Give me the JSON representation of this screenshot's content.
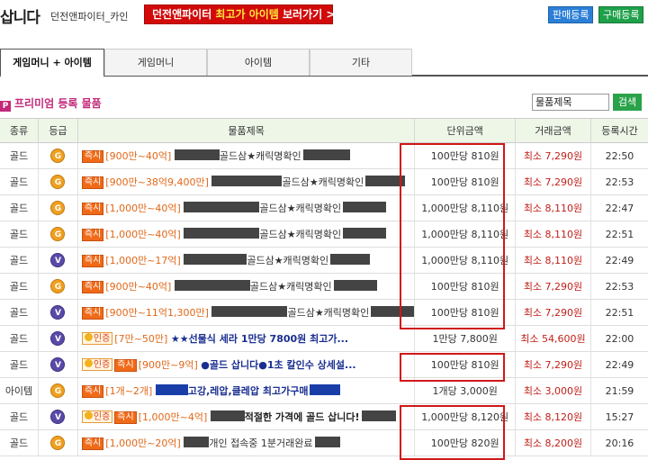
{
  "header": {
    "title": "삽니다",
    "subtitle": "던전앤파이터_카인",
    "banner_part1": "던전앤파이터 ",
    "banner_highlight": "최고가 아이템",
    "banner_part2": " 보러가기 >",
    "sell_button": "판매등록",
    "buy_button": "구매등록"
  },
  "tabs": [
    "게임머니 + 아이템",
    "게임머니",
    "아이템",
    "기타"
  ],
  "premium_label": "프리미엄 등록 물품",
  "search": {
    "select_value": "물품제목",
    "button": "검색"
  },
  "table": {
    "headers": [
      "종류",
      "등급",
      "물품제목",
      "단위금액",
      "거래금액",
      "등록시간"
    ],
    "rows": [
      {
        "type": "골드",
        "grade": "G",
        "badges": [
          "즉시"
        ],
        "range": "[900만~40억]",
        "title": "골드삼★캐릭명확인",
        "unit": "100만당 810원",
        "trade": "최소 7,290원",
        "time": "22:50"
      },
      {
        "type": "골드",
        "grade": "G",
        "badges": [
          "즉시"
        ],
        "range": "[900만~38억9,400만]",
        "title": "골드삼★캐릭명확인",
        "unit": "100만당 810원",
        "trade": "최소 7,290원",
        "time": "22:53"
      },
      {
        "type": "골드",
        "grade": "G",
        "badges": [
          "즉시"
        ],
        "range": "[1,000만~40억]",
        "title": "골드삼★캐릭명확인",
        "unit": "1,000만당 8,110원",
        "trade": "최소 8,110원",
        "time": "22:47"
      },
      {
        "type": "골드",
        "grade": "G",
        "badges": [
          "즉시"
        ],
        "range": "[1,000만~40억]",
        "title": "골드삼★캐릭명확인",
        "unit": "1,000만당 8,110원",
        "trade": "최소 8,110원",
        "time": "22:51"
      },
      {
        "type": "골드",
        "grade": "V",
        "badges": [
          "즉시"
        ],
        "range": "[1,000만~17억]",
        "title": "골드삼★캐릭명확인",
        "unit": "1,000만당 8,110원",
        "trade": "최소 8,110원",
        "time": "22:49"
      },
      {
        "type": "골드",
        "grade": "G",
        "badges": [
          "즉시"
        ],
        "range": "[900만~40억]",
        "title": "골드삼★캐릭명확인",
        "unit": "100만당 810원",
        "trade": "최소 7,290원",
        "time": "22:53"
      },
      {
        "type": "골드",
        "grade": "V",
        "badges": [
          "즉시"
        ],
        "range": "[900만~11억1,300만]",
        "title": "골드삼★캐릭명확인",
        "unit": "100만당 810원",
        "trade": "최소 7,290원",
        "time": "22:51"
      },
      {
        "type": "골드",
        "grade": "V",
        "badges": [
          "인증"
        ],
        "range": "[7만~50만]",
        "title": "★★선물식 세라 1만당 7800원 최고가...",
        "unit": "1만당 7,800원",
        "trade": "최소 54,600원",
        "time": "22:00"
      },
      {
        "type": "골드",
        "grade": "V",
        "badges": [
          "인증",
          "즉시"
        ],
        "range": "[900만~9억]",
        "title": "●골드 삽니다●1초 칼인수 상세설...",
        "unit": "100만당 810원",
        "trade": "최소 7,290원",
        "time": "22:49"
      },
      {
        "type": "아이템",
        "grade": "G",
        "badges": [
          "즉시"
        ],
        "range": "[1개~2개]",
        "title": "고강,레압,클레압 최고가구매",
        "unit": "1개당 3,000원",
        "trade": "최소 3,000원",
        "time": "21:59"
      },
      {
        "type": "골드",
        "grade": "V",
        "badges": [
          "인증",
          "즉시"
        ],
        "range": "[1,000만~4억]",
        "title": "적절한 가격에 골드 삽니다!",
        "unit": "1,000만당 8,120원",
        "trade": "최소 8,120원",
        "time": "15:27"
      },
      {
        "type": "골드",
        "grade": "G",
        "badges": [
          "즉시"
        ],
        "range": "[1,000만~20억]",
        "title": "개인 접속중 1분거래완료",
        "unit": "100만당 820원",
        "trade": "최소 8,200원",
        "time": "20:16"
      }
    ]
  }
}
